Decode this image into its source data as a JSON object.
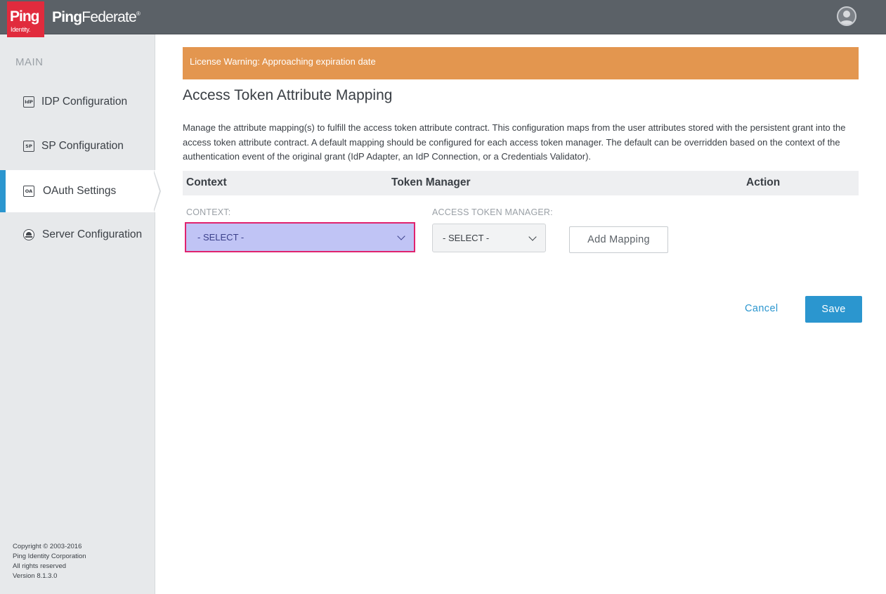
{
  "header": {
    "logo_text": "Ping",
    "logo_subtext": "Identity.",
    "product_name_bold": "Ping",
    "product_name_rest": "Federate",
    "product_mark": "®",
    "user_icon": "user-avatar-icon"
  },
  "sidebar": {
    "section_label": "MAIN",
    "items": [
      {
        "label": "IDP Configuration",
        "icon_text": "IdP",
        "icon": "idp-icon"
      },
      {
        "label": "SP Configuration",
        "icon_text": "SP",
        "icon": "sp-icon"
      },
      {
        "label": "OAuth Settings",
        "icon_text": "OA",
        "icon": "oauth-icon"
      },
      {
        "label": "Server Configuration",
        "icon": "server-icon"
      }
    ],
    "copyright": [
      "Copyright © 2003-2016",
      "Ping Identity Corporation",
      "All rights reserved",
      "Version 8.1.3.0"
    ]
  },
  "main": {
    "license_warning": "License Warning: Approaching expiration date",
    "title": "Access Token Attribute Mapping",
    "description": "Manage the attribute mapping(s) to fulfill the access token attribute contract. This configuration maps from the user attributes stored with the persistent grant into the access token attribute contract. A default mapping should be configured for each access token manager. The default can be overridden based on the context of the authentication event of the original grant (IdP Adapter, an IdP Connection, or a Credentials Validator).",
    "table_headers": [
      "Context",
      "Token Manager",
      "Action"
    ],
    "context_label": "CONTEXT:",
    "context_value": "- SELECT -",
    "manager_label": "ACCESS TOKEN MANAGER:",
    "manager_value": "- SELECT -",
    "add_mapping": "Add Mapping",
    "cancel": "Cancel",
    "save": "Save"
  },
  "colors": {
    "accent": "#2b96cf",
    "warning": "#e3964f",
    "brand_red": "#e12b3d",
    "focus_border": "#e0236e"
  }
}
